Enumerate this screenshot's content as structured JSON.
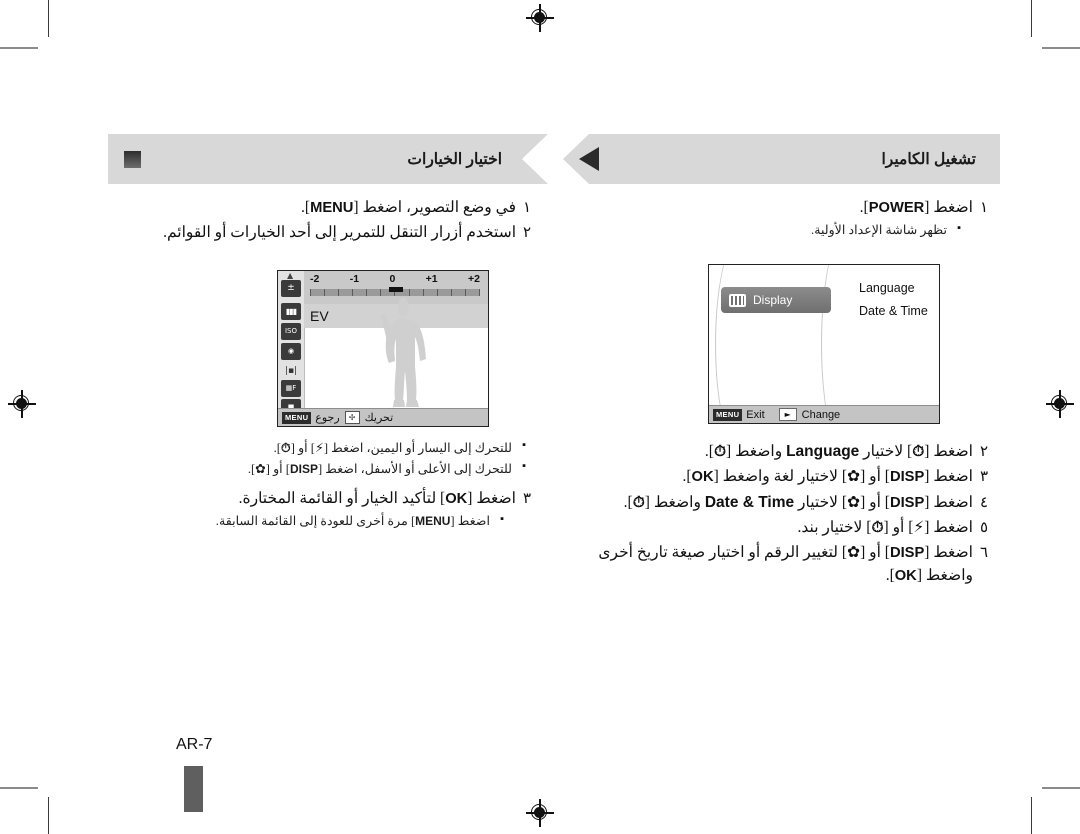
{
  "page": {
    "number_label": "AR-7",
    "accent_gray": "#d8d8d8",
    "text_color": "#111111"
  },
  "left_section": {
    "banner_title": "اختيار الخيارات",
    "marker_icon": "square-marker-icon",
    "steps": [
      {
        "num": "١",
        "text_html": "في وضع التصوير، اضغط [MENU].",
        "bullets": []
      },
      {
        "num": "٢",
        "text_html": "استخدم أزرار التنقل للتمرير إلى أحد الخيارات أو القوائم.",
        "bullets": []
      }
    ],
    "post_image_bullets": [
      "للتحرك إلى اليسار أو اليمين، اضغط [⚡] أو [⏱].",
      "للتحرك إلى الأعلى أو الأسفل، اضغط [DISP] أو [🌷]."
    ],
    "step3": {
      "num": "٣",
      "text": "اضغط [OK] لتأكيد الخيار أو القائمة المختارة.",
      "bullets": [
        "اضغط [MENU] مرة أخرى للعودة إلى القائمة السابقة."
      ]
    },
    "lcd": {
      "name": "ev-adjust-screen",
      "scale_labels": [
        "-2",
        "-1",
        "0",
        "+1",
        "+2"
      ],
      "scale_value": "0",
      "option_label": "EV",
      "icons": [
        "exposure-compensation-icon",
        "white-balance-icon",
        "iso-icon",
        "face-detect-off-icon",
        "focus-area-icon",
        "image-quality-f-icon",
        "voice-off-icon"
      ],
      "bottom_left_chip": "MENU",
      "bottom_left_label": "رجوع",
      "bottom_center_chip": "dpad-icon",
      "bottom_center_label": "تحريك"
    }
  },
  "right_section": {
    "banner_title": "تشغيل الكاميرا",
    "marker_icon": "left-triangle-icon",
    "step1": {
      "num": "١",
      "text": "اضغط [POWER].",
      "bullets": [
        "تظهر شاشة الإعداد الأولية."
      ]
    },
    "steps": [
      {
        "num": "٢",
        "text": "اضغط [⏱] لاختيار Language واضغط [⏱]."
      },
      {
        "num": "٣",
        "text": "اضغط [DISP] أو [🌷] لاختيار لغة واضغط [OK]."
      },
      {
        "num": "٤",
        "text": "اضغط [DISP] أو [🌷] لاختيار Date & Time واضغط [⏱]."
      },
      {
        "num": "٥",
        "text": "اضغط [⚡] أو [⏱] لاختيار بند."
      },
      {
        "num": "٦",
        "text": "اضغط [DISP] أو [🌷] لتغيير الرقم أو اختيار صيغة تاريخ أخرى واضغط [OK]."
      }
    ],
    "lcd": {
      "name": "initial-setup-screen",
      "tab_label": "Display",
      "tab_icon": "display-icon",
      "menu_items": [
        "Language",
        "Date & Time"
      ],
      "bottom_left_chip": "MENU",
      "bottom_left_label": "Exit",
      "bottom_right_chip": "►",
      "bottom_right_label": "Change"
    }
  }
}
